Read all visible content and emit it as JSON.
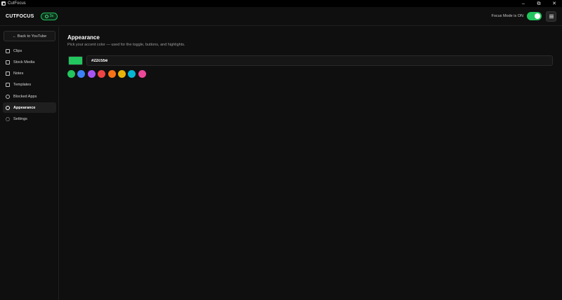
{
  "window": {
    "title": "CutFocus",
    "minimize": "–",
    "maximize": "⧉",
    "close": "✕"
  },
  "header": {
    "brand": "CUTFOCUS",
    "timer": "3s",
    "focus_mode_label": "Focus Mode is ON",
    "focus_mode_on": true
  },
  "sidebar": {
    "back_label": "← Back to YouTube",
    "items": [
      {
        "label": "Clips",
        "icon": "clip-icon",
        "active": false
      },
      {
        "label": "Stock Media",
        "icon": "image-icon",
        "active": false
      },
      {
        "label": "Notes",
        "icon": "note-icon",
        "active": false
      },
      {
        "label": "Templates",
        "icon": "template-icon",
        "active": false
      },
      {
        "label": "Blocked Apps",
        "icon": "block-icon",
        "active": false
      },
      {
        "label": "Appearance",
        "icon": "palette-icon",
        "active": true
      },
      {
        "label": "Settings",
        "icon": "gear-icon",
        "active": false
      }
    ]
  },
  "main": {
    "title": "Appearance",
    "description": "Pick your accent color — used for the toggle, buttons, and highlights.",
    "accent_hex": "#22c55e",
    "palette": [
      "#22c55e",
      "#3b82f6",
      "#a855f7",
      "#ef4444",
      "#f97316",
      "#eab308",
      "#06b6d4",
      "#ec4899"
    ]
  }
}
